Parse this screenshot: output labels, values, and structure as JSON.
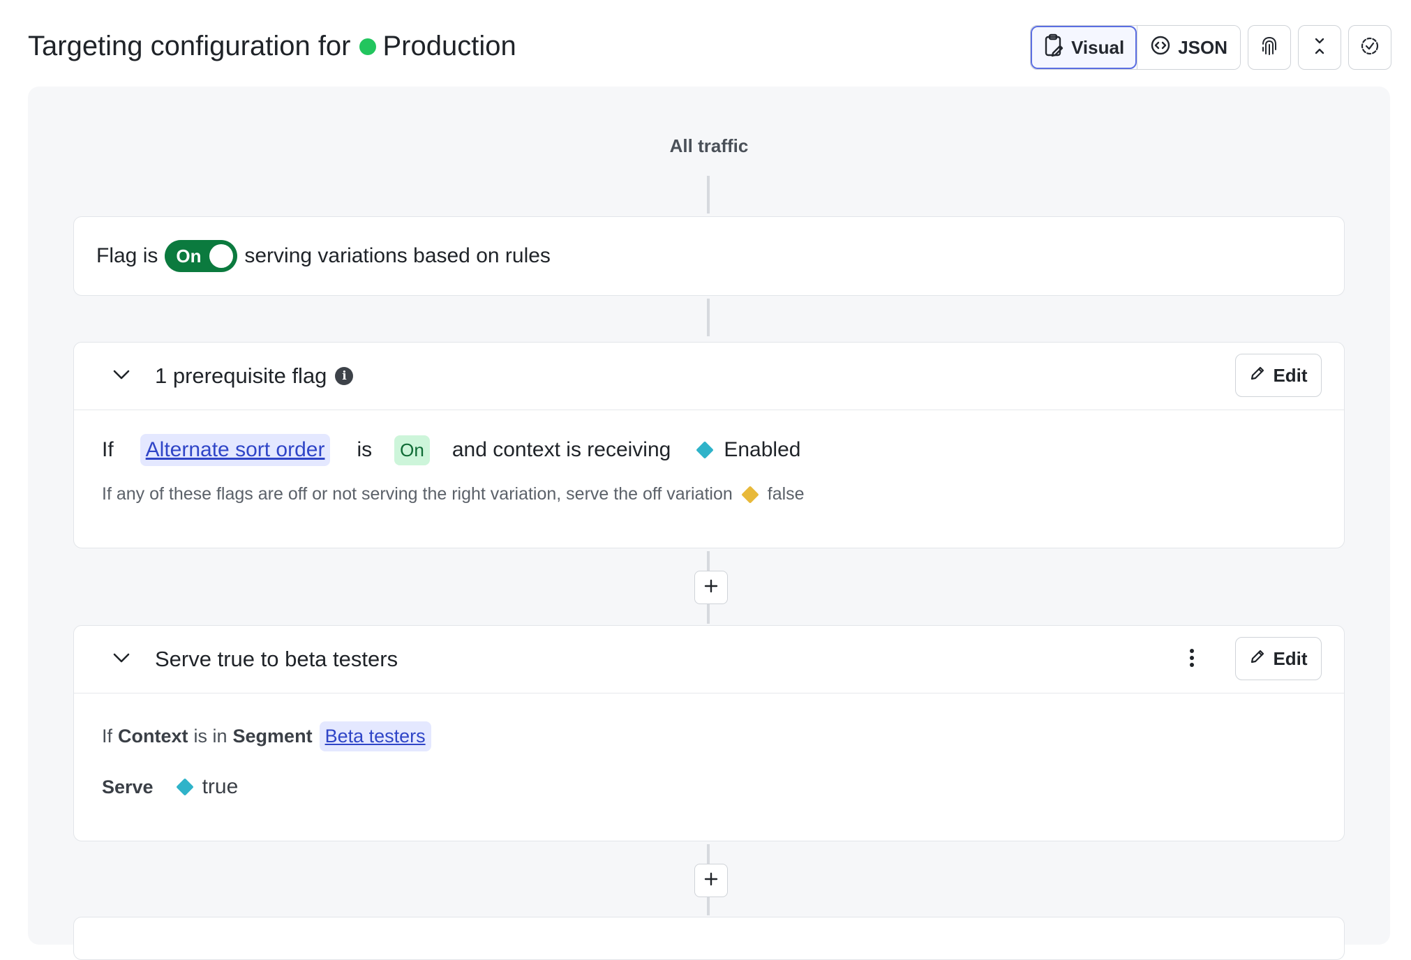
{
  "header": {
    "title_prefix": "Targeting configuration for",
    "environment": "Production",
    "env_color": "#22c55e",
    "view_modes": [
      {
        "label": "Visual",
        "icon": "clipboard-edit-icon",
        "active": true
      },
      {
        "label": "JSON",
        "icon": "code-circle-icon",
        "active": false
      }
    ],
    "icon_buttons": [
      "fingerprint-icon",
      "collapse-icon",
      "check-circle-icon"
    ]
  },
  "canvas": {
    "all_traffic_label": "All traffic",
    "flag_status": {
      "prefix": "Flag is",
      "toggle_label": "On",
      "suffix": "serving variations based on rules"
    },
    "prerequisites": {
      "title": "1 prerequisite flag",
      "edit_label": "Edit",
      "clause": {
        "if": "If",
        "flag_name": "Alternate sort order",
        "is": "is",
        "state": "On",
        "receiving": "and context is receiving",
        "variation": "Enabled",
        "variation_color": "#2fb3c9"
      },
      "note": "If any of these flags are off or not serving the right variation, serve the off variation",
      "off_variation": "false",
      "off_variation_color": "#e8b93a"
    },
    "rule": {
      "title": "Serve true to beta testers",
      "edit_label": "Edit",
      "clause": {
        "if": "If",
        "attribute": "Context",
        "op": "is in",
        "kind": "Segment",
        "segment": "Beta testers"
      },
      "serve_label": "Serve",
      "serve_value": "true",
      "serve_color": "#2fb3c9"
    }
  }
}
